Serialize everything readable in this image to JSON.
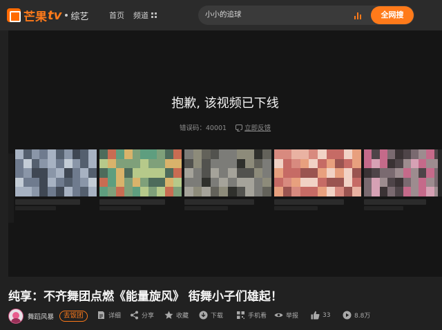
{
  "header": {
    "logo_cn": "芒果",
    "logo_tv": "tv",
    "logo_sub": "综艺",
    "nav": {
      "home": "首页",
      "channel": "频道"
    },
    "search": {
      "value": "小小的追球",
      "button": "全网搜"
    }
  },
  "player": {
    "error_title": "抱歉, 该视频已下线",
    "error_code": "错误码：40001",
    "feedback": "立即反馈"
  },
  "video": {
    "title": "纯享：不齐舞团点燃《能量旋风》 街舞小子们雄起！",
    "author": "舞蹈风暴",
    "fan_button": "去饭团",
    "actions": {
      "detail": "详细",
      "share": "分享",
      "favorite": "收藏",
      "download": "下载",
      "mobile": "手机看",
      "report": "举报",
      "likes": "33",
      "plays": "8.8万"
    }
  },
  "colors": {
    "accent": "#ff7a1a",
    "background": "#212121",
    "player": "#151515"
  }
}
